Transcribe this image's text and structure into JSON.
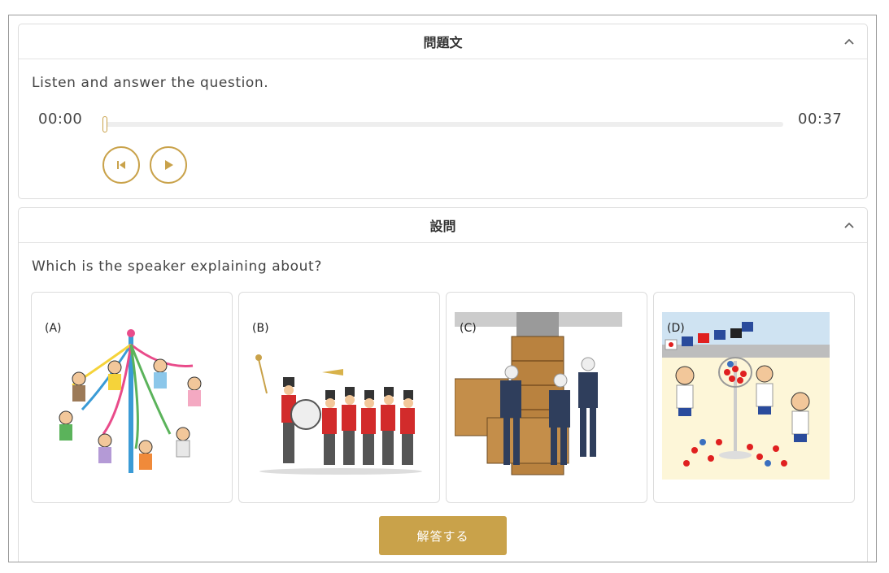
{
  "passage_panel": {
    "title": "問題文",
    "instruction": "Listen and answer the question."
  },
  "audio_player": {
    "current_time": "00:00",
    "duration": "00:37",
    "progress": 0
  },
  "question_panel": {
    "title": "設問",
    "question": "Which is the speaker explaining about?"
  },
  "choices": [
    {
      "label": "(A)",
      "image": "maypole-dance-illustration"
    },
    {
      "label": "(B)",
      "image": "marching-band-illustration"
    },
    {
      "label": "(C)",
      "image": "construction-workers-illustration"
    },
    {
      "label": "(D)",
      "image": "ball-toss-game-illustration"
    }
  ],
  "submit_label": "解答する",
  "colors": {
    "accent": "#c9a24a",
    "border": "#dcdcdc",
    "text": "#444444"
  },
  "icons": [
    "chevron-up-icon",
    "skip-back-icon",
    "play-icon"
  ]
}
